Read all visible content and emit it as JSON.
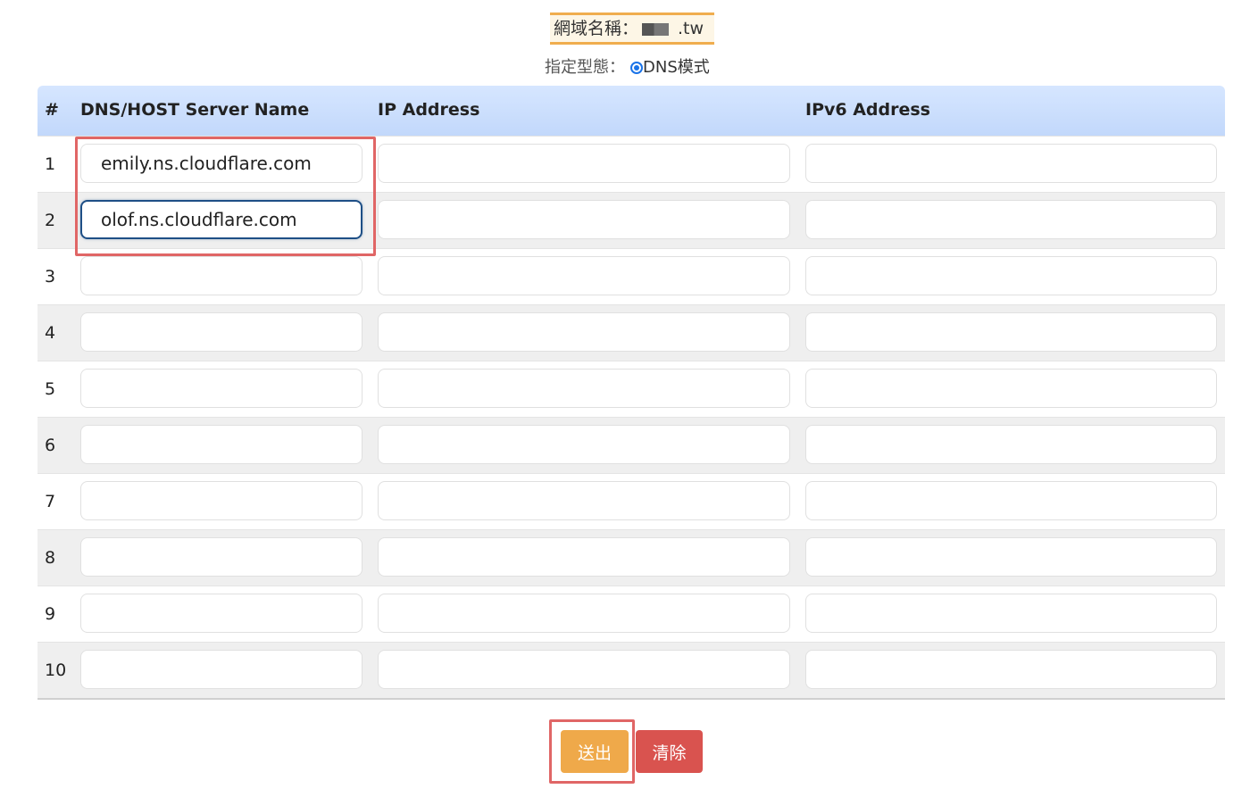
{
  "header": {
    "domain_label": "網域名稱：",
    "domain_suffix": ".tw",
    "mode_label": "指定型態：",
    "mode_option": "DNS模式"
  },
  "table": {
    "columns": {
      "num": "#",
      "name": "DNS/HOST Server Name",
      "ip": "IP Address",
      "ipv6": "IPv6 Address"
    },
    "rows": [
      {
        "num": "1",
        "name": "emily.ns.cloudflare.com",
        "ip": "",
        "ipv6": ""
      },
      {
        "num": "2",
        "name": "olof.ns.cloudflare.com",
        "ip": "",
        "ipv6": ""
      },
      {
        "num": "3",
        "name": "",
        "ip": "",
        "ipv6": ""
      },
      {
        "num": "4",
        "name": "",
        "ip": "",
        "ipv6": ""
      },
      {
        "num": "5",
        "name": "",
        "ip": "",
        "ipv6": ""
      },
      {
        "num": "6",
        "name": "",
        "ip": "",
        "ipv6": ""
      },
      {
        "num": "7",
        "name": "",
        "ip": "",
        "ipv6": ""
      },
      {
        "num": "8",
        "name": "",
        "ip": "",
        "ipv6": ""
      },
      {
        "num": "9",
        "name": "",
        "ip": "",
        "ipv6": ""
      },
      {
        "num": "10",
        "name": "",
        "ip": "",
        "ipv6": ""
      }
    ]
  },
  "actions": {
    "submit_label": "送出",
    "clear_label": "清除"
  },
  "colors": {
    "header_bg": "#c9dcfb",
    "submit": "#efa94a",
    "clear": "#d9534f",
    "highlight": "#e06666",
    "focus_border": "#1e4f86"
  }
}
